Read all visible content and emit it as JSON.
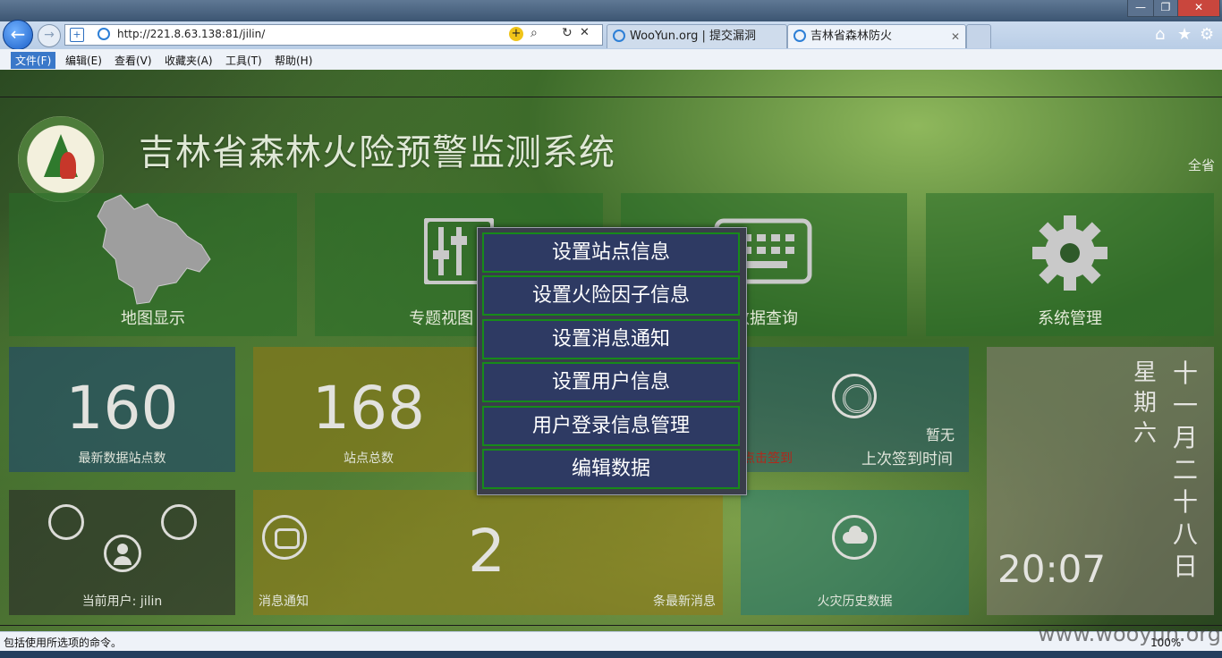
{
  "browser": {
    "url": "http://221.8.63.138:81/jilin/",
    "tabs": [
      {
        "label": "WooYun.org | 提交漏洞"
      },
      {
        "label": "吉林省森林防火"
      }
    ],
    "window_buttons": {
      "minimize": "—",
      "restore": "❐",
      "close": "✕"
    },
    "toolbar_icons": [
      "home-icon",
      "star-icon",
      "gear-icon"
    ]
  },
  "menubar": {
    "items": [
      "文件(F)",
      "编辑(E)",
      "查看(V)",
      "收藏夹(A)",
      "工具(T)",
      "帮助(H)"
    ]
  },
  "page": {
    "title": "吉林省森林火险预警监测系统",
    "region": "全省",
    "tiles": {
      "map": "地图显示",
      "thematic": "专题视图  统",
      "query": "数据查询",
      "system": "系统管理",
      "latest_count": "160",
      "latest_label": "最新数据站点数",
      "total_count": "168",
      "total_label": "站点总数",
      "checkin_status": "暂无",
      "checkin_label": "上次签到时间",
      "checkin_link": "点击签到",
      "current_user": "当前用户: jilin",
      "notice_label": "消息通知",
      "notice_count": "2",
      "notice_unit": "条最新消息",
      "fire_history": "火灾历史数据",
      "weekday": "星期六",
      "date": "十一月二十八日",
      "time": "20:07"
    }
  },
  "dialog": {
    "items": [
      "设置站点信息",
      "设置火险因子信息",
      "设置消息通知",
      "设置用户信息",
      "用户登录信息管理",
      "编辑数据"
    ]
  },
  "status": {
    "text": "包括使用所选项的命令。",
    "zoom": "100%",
    "watermark": "www.wooyun.org"
  }
}
